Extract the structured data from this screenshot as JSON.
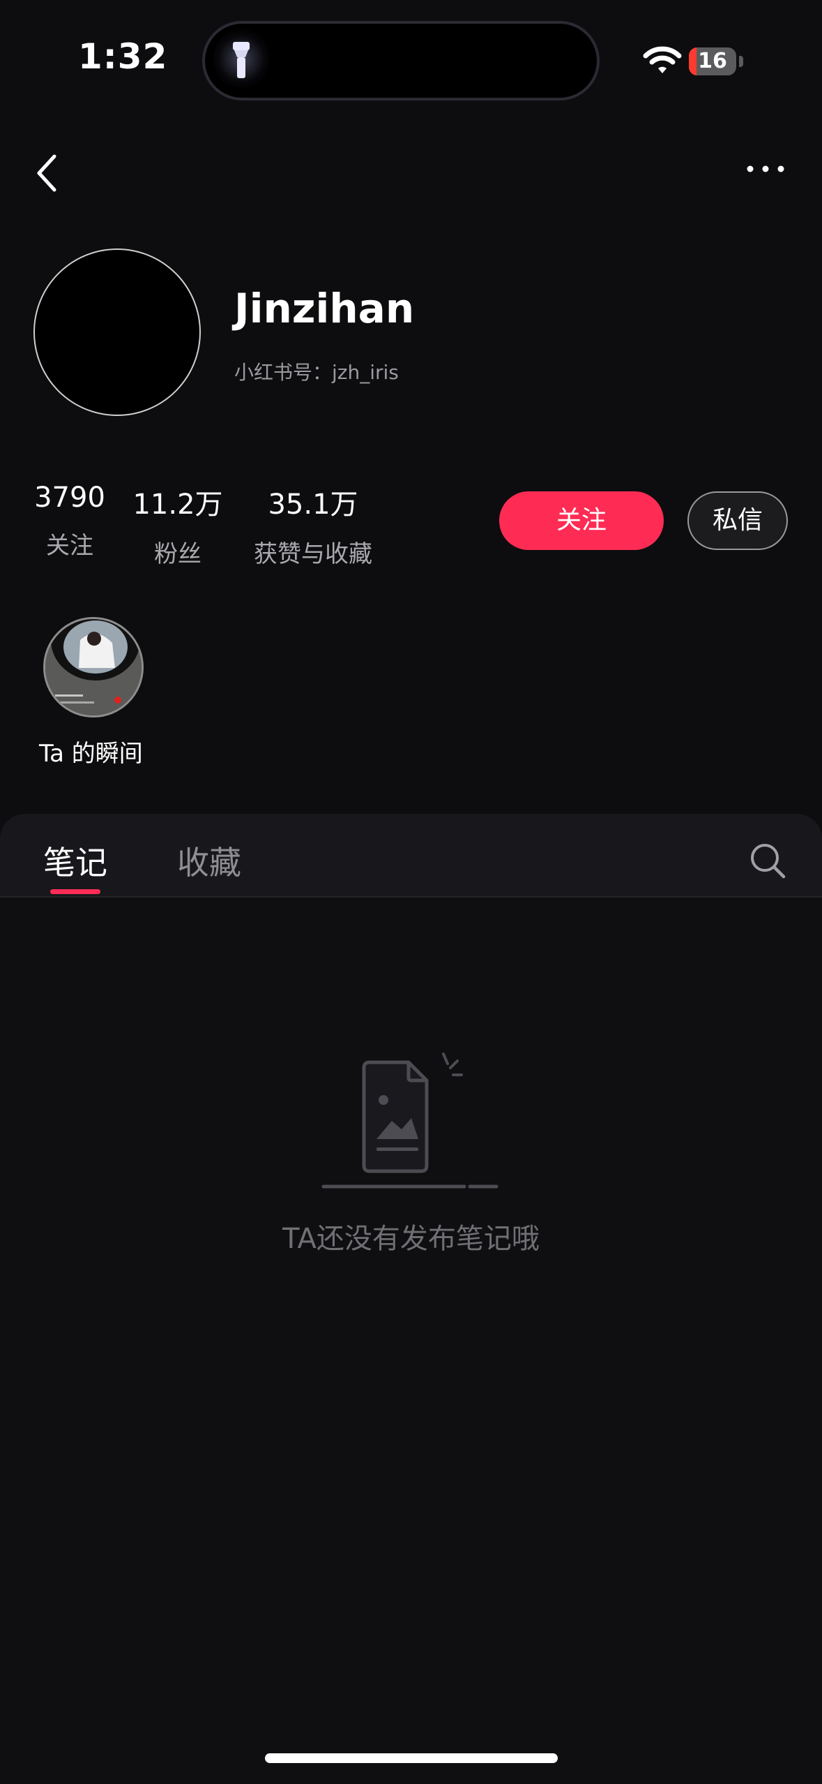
{
  "status_bar": {
    "time": "1:32",
    "battery_level": "16",
    "battery_fraction": 0.16,
    "icons": [
      "flashlight-icon",
      "wifi-icon",
      "battery-icon"
    ]
  },
  "header": {
    "back_icon": "back-icon",
    "more_icon": "more-icon"
  },
  "profile": {
    "name": "Jinzihan",
    "id_text": "小红书号：jzh_iris"
  },
  "stats": [
    {
      "value": "3790",
      "label": "关注"
    },
    {
      "value": "11.2万",
      "label": "粉丝"
    },
    {
      "value": "35.1万",
      "label": "获赞与收藏"
    }
  ],
  "actions": {
    "follow_label": "关注",
    "message_label": "私信"
  },
  "moments": {
    "label": "Ta 的瞬间"
  },
  "tabs": [
    {
      "label": "笔记",
      "active": true
    },
    {
      "label": "收藏",
      "active": false
    }
  ],
  "empty_state": {
    "text": "TA还没有发布笔记哦"
  },
  "colors": {
    "accent": "#fe2c55",
    "background": "#0d0d0f",
    "panel": "#18181c",
    "muted_text": "#8e8e93"
  }
}
